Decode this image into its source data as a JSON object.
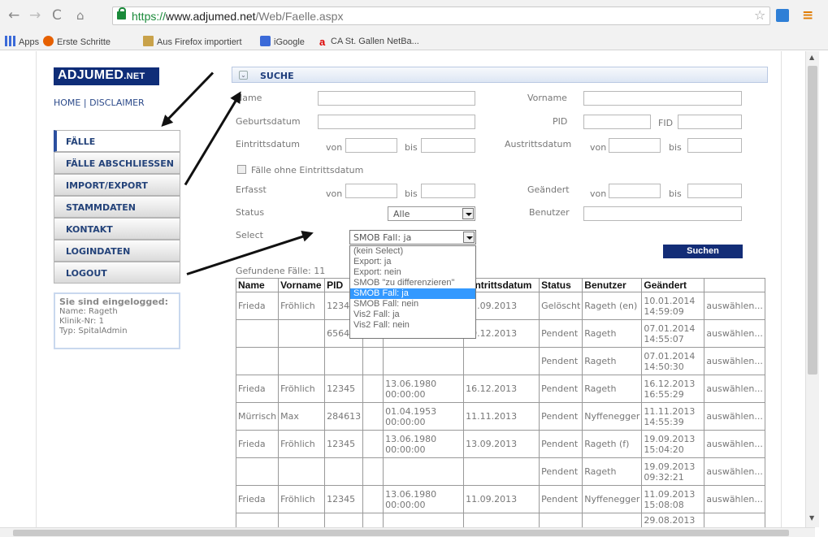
{
  "browser": {
    "url_scheme": "https://",
    "url_domain": "www.adjumed.net",
    "url_path": "/Web/Faelle.aspx",
    "bookmarks": [
      "Apps",
      "Erste Schritte",
      "Aus Firefox importiert",
      "iGoogle",
      "CA St. Gallen NetBa..."
    ]
  },
  "site": {
    "logo_main": "ADJUMED",
    "logo_suffix": ".NET",
    "toplinks": "HOME | DISCLAIMER"
  },
  "menu": {
    "items": [
      "FÄLLE",
      "FÄLLE ABSCHLIESSEN",
      "IMPORT/EXPORT",
      "STAMMDATEN",
      "KONTAKT",
      "LOGINDATEN",
      "LOGOUT"
    ]
  },
  "login": {
    "heading": "Sie sind eingelogged:",
    "name": "Name: Rageth",
    "klinik": "Klinik-Nr: 1",
    "typ": "Typ: SpitalAdmin"
  },
  "search": {
    "title": "SUCHE",
    "name_label": "Name",
    "vorname_label": "Vorname",
    "geburtsdatum_label": "Geburtsdatum",
    "pid_label": "PID",
    "fid_label": "FID",
    "eintrittsdatum_label": "Eintrittsdatum",
    "austrittsdatum_label": "Austrittsdatum",
    "von_label": "von",
    "bis_label": "bis",
    "ohne_eintritt_label": "Fälle ohne Eintrittsdatum",
    "erfasst_label": "Erfasst",
    "geaendert_label": "Geändert",
    "status_label": "Status",
    "status_value": "Alle",
    "benutzer_label": "Benutzer",
    "select_label": "Select",
    "select_value": "SMOB Fall: ja",
    "select_options": [
      "(kein Select)",
      "Export: ja",
      "Export: nein",
      "SMOB \"zu differenzieren\"",
      "SMOB Fall: ja",
      "SMOB Fall: nein",
      "Vis2 Fall: ja",
      "Vis2 Fall: nein"
    ],
    "submit_label": "Suchen"
  },
  "results": {
    "count_text": "Gefundene Fälle: 11",
    "headers": [
      "Name",
      "Vorname",
      "PID",
      "",
      "Eintrittsdatum",
      "Status",
      "Benutzer",
      "Geändert",
      ""
    ],
    "rows": [
      [
        "Frieda",
        "Fröhlich",
        "1234",
        "",
        "",
        "12.09.2013",
        "Gelöscht",
        "Rageth (en)",
        "10.01.2014 14:59:09",
        "auswählen..."
      ],
      [
        "",
        "",
        "6564",
        "",
        "",
        "09.12.2013",
        "Pendent",
        "Rageth",
        "07.01.2014 14:55:07",
        "auswählen..."
      ],
      [
        "",
        "",
        "",
        "",
        "",
        "",
        "Pendent",
        "Rageth",
        "07.01.2014 14:50:30",
        "auswählen..."
      ],
      [
        "Frieda",
        "Fröhlich",
        "12345",
        "",
        "13.06.1980 00:00:00",
        "16.12.2013",
        "Pendent",
        "Rageth",
        "16.12.2013 16:55:29",
        "auswählen..."
      ],
      [
        "Mürrisch",
        "Max",
        "284613",
        "",
        "01.04.1953 00:00:00",
        "11.11.2013",
        "Pendent",
        "Nyffenegger",
        "11.11.2013 14:55:39",
        "auswählen..."
      ],
      [
        "Frieda",
        "Fröhlich",
        "12345",
        "",
        "13.06.1980 00:00:00",
        "13.09.2013",
        "Pendent",
        "Rageth (f)",
        "19.09.2013 15:04:20",
        "auswählen..."
      ],
      [
        "",
        "",
        "",
        "",
        "",
        "",
        "Pendent",
        "Rageth",
        "19.09.2013 09:32:21",
        "auswählen..."
      ],
      [
        "Frieda",
        "Fröhlich",
        "12345",
        "",
        "13.06.1980 00:00:00",
        "11.09.2013",
        "Pendent",
        "Nyffenegger",
        "11.09.2013 15:08:08",
        "auswählen..."
      ],
      [
        "",
        "",
        "",
        "",
        "",
        "",
        "",
        "",
        "29.08.2013",
        ""
      ]
    ]
  }
}
